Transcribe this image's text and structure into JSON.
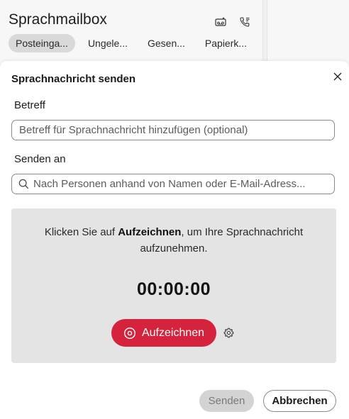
{
  "app": {
    "title": "Sprachmailbox",
    "header_icons": [
      "voicemail-icon",
      "phone-settings-icon"
    ]
  },
  "tabs": [
    {
      "label": "Posteinga...",
      "active": true
    },
    {
      "label": "Ungele...",
      "active": false
    },
    {
      "label": "Gesen...",
      "active": false
    },
    {
      "label": "Papierk...",
      "active": false
    }
  ],
  "dialog": {
    "title": "Sprachnachricht senden",
    "subject_label": "Betreff",
    "subject_placeholder": "Betreff für Sprachnachricht hinzufügen (optional)",
    "subject_value": "",
    "recipient_label": "Senden an",
    "recipient_placeholder": "Nach Personen anhand von Namen oder E-Mail-Adress...",
    "recipient_value": "",
    "instruction_pre": "Klicken Sie auf ",
    "instruction_bold": "Aufzeichnen",
    "instruction_post": ", um Ihre Sprachnachricht aufzunehmen.",
    "timer": "00:00:00",
    "record_label": "Aufzeichnen",
    "send_label": "Senden",
    "cancel_label": "Abbrechen"
  },
  "colors": {
    "record": "#d5233e",
    "active_tab": "#d9d9d9",
    "recorder_bg": "#e4e4e4"
  }
}
